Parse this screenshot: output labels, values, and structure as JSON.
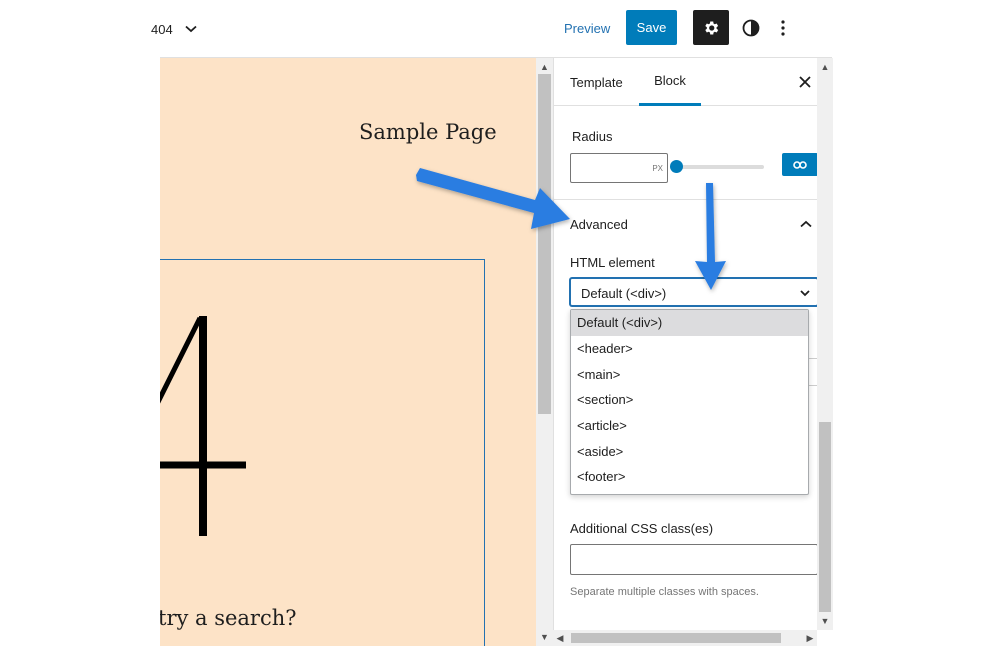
{
  "toolbar": {
    "template_name": "404",
    "preview_label": "Preview",
    "save_label": "Save"
  },
  "canvas": {
    "site_title": "Sample Page",
    "heading_fragment": "4",
    "search_hint": "try a search?",
    "background_color": "#fde3c7",
    "selected_outline_color": "#2271b1"
  },
  "sidebar": {
    "tabs": [
      {
        "label": "Template"
      },
      {
        "label": "Block",
        "active": true
      }
    ],
    "radius": {
      "label": "Radius",
      "value": "",
      "unit": "PX"
    },
    "advanced": {
      "label": "Advanced",
      "html_element": {
        "label": "HTML element",
        "selected": "Default (<div>)",
        "options": [
          "Default (<div>)",
          "<header>",
          "<main>",
          "<section>",
          "<article>",
          "<aside>",
          "<footer>"
        ]
      },
      "css_classes": {
        "label": "Additional CSS class(es)",
        "value": "",
        "help": "Separate multiple classes with spaces."
      }
    }
  },
  "colors": {
    "accent": "#007cba",
    "annotation_arrow": "#2a7de1"
  },
  "icons": [
    "chevron-down-icon",
    "gear-icon",
    "contrast-icon",
    "vertical-ellipsis-icon",
    "close-icon",
    "link-icon",
    "chevron-up-icon"
  ]
}
